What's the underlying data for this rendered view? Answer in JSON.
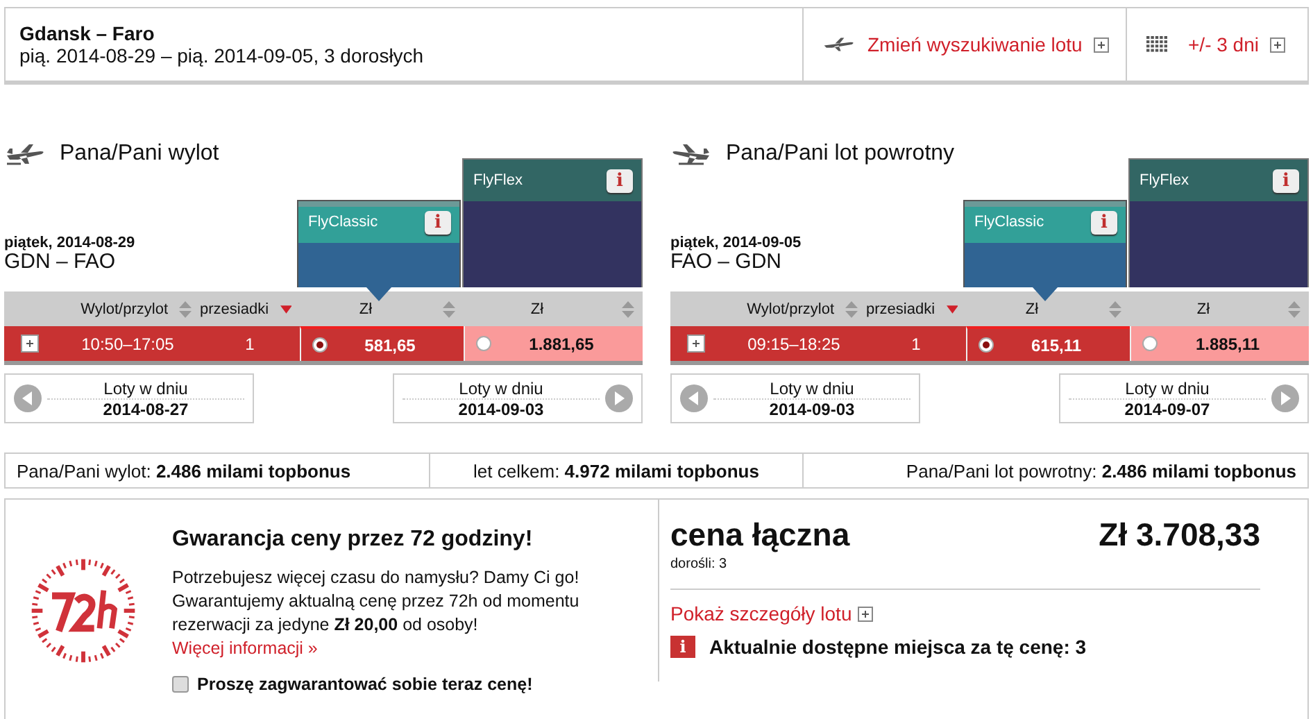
{
  "search": {
    "route": "Gdansk – Faro",
    "details": "pią. 2014-08-29 – pią. 2014-09-05, 3 dorosłych",
    "actions": [
      {
        "kind": "change",
        "label": "Zmień wyszukiwanie lotu"
      },
      {
        "kind": "flex",
        "label": "+/- 3 dni"
      }
    ]
  },
  "flights": [
    {
      "kind": "outbound",
      "heading": "Pana/Pani wylot",
      "date": "piątek, 2014-08-29",
      "route": "GDN – FAO",
      "fares": [
        {
          "name": "FlyClassic",
          "info": "i",
          "selected": true
        },
        {
          "name": "FlyFlex",
          "info": "i",
          "selected": false
        }
      ],
      "columns": [
        {
          "label": "Wylot/przylot",
          "sorted": false
        },
        {
          "label": "przesiadki",
          "sorted": true
        },
        {
          "label": "Zł",
          "sorted": false
        },
        {
          "label": "Zł",
          "sorted": false
        }
      ],
      "row": {
        "time": "10:50–17:05",
        "stops": "1",
        "prices": [
          {
            "value": "581,65",
            "selected": true
          },
          {
            "value": "1.881,65",
            "selected": false
          }
        ]
      },
      "nav": [
        {
          "label": "Loty w dniu",
          "date": "2014-08-27"
        },
        {
          "label": "Loty w dniu",
          "date": "2014-09-03"
        }
      ]
    },
    {
      "kind": "return",
      "heading": "Pana/Pani lot powrotny",
      "date": "piątek, 2014-09-05",
      "route": "FAO – GDN",
      "fares": [
        {
          "name": "FlyClassic",
          "info": "i",
          "selected": true
        },
        {
          "name": "FlyFlex",
          "info": "i",
          "selected": false
        }
      ],
      "columns": [
        {
          "label": "Wylot/przylot",
          "sorted": false
        },
        {
          "label": "przesiadki",
          "sorted": true
        },
        {
          "label": "Zł",
          "sorted": false
        },
        {
          "label": "Zł",
          "sorted": false
        }
      ],
      "row": {
        "time": "09:15–18:25",
        "stops": "1",
        "prices": [
          {
            "value": "615,11",
            "selected": true
          },
          {
            "value": "1.885,11",
            "selected": false
          }
        ]
      },
      "nav": [
        {
          "label": "Loty w dniu",
          "date": "2014-09-03"
        },
        {
          "label": "Loty w dniu",
          "date": "2014-09-07"
        }
      ]
    }
  ],
  "miles": [
    {
      "label": "Pana/Pani wylot:",
      "value": "2.486 milami topbonus"
    },
    {
      "label": "let celkem:",
      "value": "4.972 milami topbonus"
    },
    {
      "label": "Pana/Pani lot powrotny:",
      "value": "2.486 milami topbonus"
    }
  ],
  "guarantee": {
    "title": "Gwarancja ceny przez 72 godziny!",
    "text": "Potrzebujesz więcej czasu do namysłu? Damy Ci go! Gwarantujemy aktualną cenę przez 72h od momentu rezerwacji za jedyne **Zł 20,00** od osoby!",
    "link": "Więcej informacji »",
    "checkbox": {
      "label": "Proszę zagwarantować sobie teraz cenę!",
      "checked": false
    }
  },
  "total": {
    "title": "cena łączna",
    "price": "Zł 3.708,33",
    "passengers": "dorośli: 3",
    "details_link": "Pokaż szczegóły lotu",
    "availability_icon": "i",
    "availability": "Aktualnie dostępne miejsca za tę cenę: 3"
  }
}
